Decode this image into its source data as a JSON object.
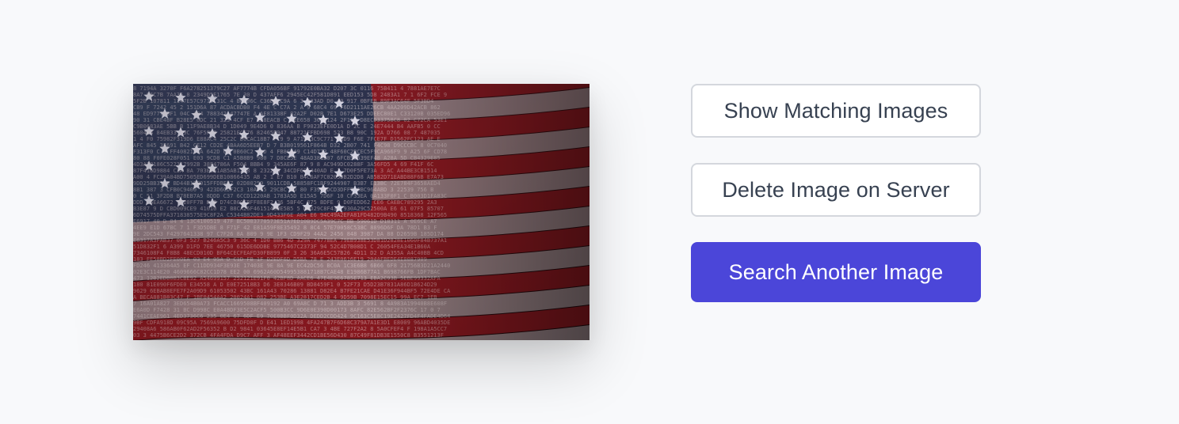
{
  "preview": {
    "image_description_icon": "american-flag-digital-image"
  },
  "actions": {
    "show_matching_label": "Show Matching Images",
    "delete_label": "Delete Image on Server",
    "search_another_label": "Search Another Image"
  },
  "colors": {
    "background": "#f8f9fb",
    "primary": "#4b46d9",
    "outline_border": "#d4d7dd",
    "outline_text": "#374151"
  }
}
